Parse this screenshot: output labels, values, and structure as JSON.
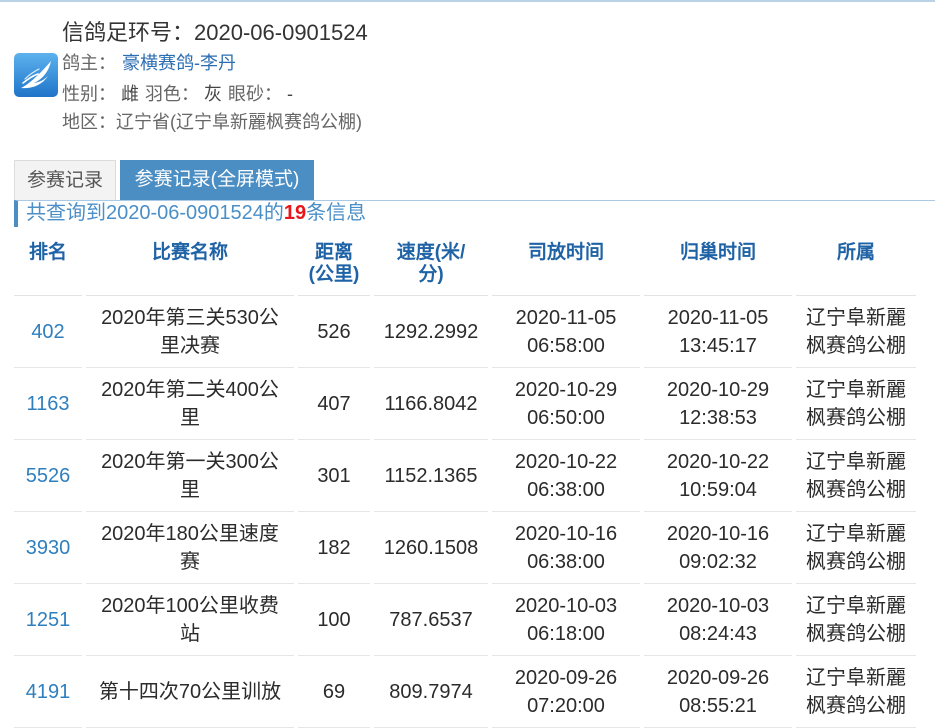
{
  "header": {
    "ring_label": "信鸽足环号：",
    "ring_number": "2020-06-0901524",
    "owner_label": "鸽主：",
    "owner_name": "豪横赛鸽-李丹",
    "sex_label": "性别：",
    "sex": "雌",
    "feather_color_label": "羽色：",
    "feather_color": "灰",
    "eye_label": "眼砂：",
    "eye": "-",
    "region_label": "地区：",
    "region": "辽宁省(辽宁阜新麗枫赛鸽公棚)"
  },
  "logo": {
    "icon": "pigeon-feather-icon"
  },
  "tabs": [
    {
      "label": "参赛记录",
      "active": false
    },
    {
      "label": "参赛记录(全屏模式)",
      "active": true
    }
  ],
  "summary": {
    "prefix": "共查询到",
    "ring_number": "2020-06-0901524",
    "joiner": "的",
    "count": 19,
    "suffix": "条信息"
  },
  "table": {
    "columns": [
      "排名",
      "比赛名称",
      "距离(公里)",
      "速度(米/分)",
      "司放时间",
      "归巢时间",
      "所属"
    ],
    "rows": [
      {
        "rank": "402",
        "race": "2020年第三关530公里决赛",
        "distance": "526",
        "speed": "1292.2992",
        "release_time": "2020-11-05 06:58:00",
        "return_time": "2020-11-05 13:45:17",
        "loft": "辽宁阜新麗枫赛鸽公棚"
      },
      {
        "rank": "1163",
        "race": "2020年第二关400公里",
        "distance": "407",
        "speed": "1166.8042",
        "release_time": "2020-10-29 06:50:00",
        "return_time": "2020-10-29 12:38:53",
        "loft": "辽宁阜新麗枫赛鸽公棚"
      },
      {
        "rank": "5526",
        "race": "2020年第一关300公里",
        "distance": "301",
        "speed": "1152.1365",
        "release_time": "2020-10-22 06:38:00",
        "return_time": "2020-10-22 10:59:04",
        "loft": "辽宁阜新麗枫赛鸽公棚"
      },
      {
        "rank": "3930",
        "race": "2020年180公里速度赛",
        "distance": "182",
        "speed": "1260.1508",
        "release_time": "2020-10-16 06:38:00",
        "return_time": "2020-10-16 09:02:32",
        "loft": "辽宁阜新麗枫赛鸽公棚"
      },
      {
        "rank": "1251",
        "race": "2020年100公里收费站",
        "distance": "100",
        "speed": "787.6537",
        "release_time": "2020-10-03 06:18:00",
        "return_time": "2020-10-03 08:24:43",
        "loft": "辽宁阜新麗枫赛鸽公棚"
      },
      {
        "rank": "4191",
        "race": "第十四次70公里训放",
        "distance": "69",
        "speed": "809.7974",
        "release_time": "2020-09-26 07:20:00",
        "return_time": "2020-09-26 08:55:21",
        "loft": "辽宁阜新麗枫赛鸽公棚"
      }
    ]
  },
  "colors": {
    "accent": "#4b8ec3",
    "header_text": "#1f63a6",
    "link": "#2f7fbe",
    "count_highlight": "#e8161a"
  }
}
